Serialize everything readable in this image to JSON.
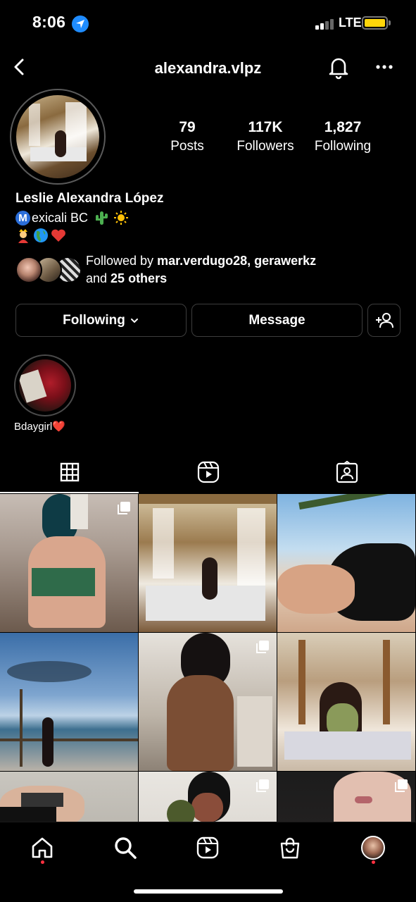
{
  "status_bar": {
    "time": "8:06",
    "network": "LTE",
    "colors": {
      "location": "#1f8cff",
      "battery": "#ffd60a"
    }
  },
  "header": {
    "username": "alexandra.vlpz",
    "icons": [
      "back-chevron-icon",
      "bell-icon",
      "more-icon"
    ]
  },
  "profile": {
    "stats": [
      {
        "value": "79",
        "label": "Posts"
      },
      {
        "value": "117K",
        "label": "Followers"
      },
      {
        "value": "1,827",
        "label": "Following"
      }
    ],
    "full_name": "Leslie Alexandra López",
    "bio_line1_badge": "M",
    "bio_line1_text": "exicali BC",
    "bio_line1_emojis": [
      "cactus",
      "sun"
    ],
    "bio_line2_emojis": [
      "woman-with-crown",
      "globe-americas",
      "red-heart"
    ],
    "followed_by": {
      "prefix": "Followed by ",
      "names": "mar.verdugo28, gerawerkz",
      "line2_prefix": "and ",
      "others": "25 others"
    }
  },
  "actions": {
    "following": "Following",
    "message": "Message"
  },
  "highlights": [
    {
      "label": "Bdaygirl❤️"
    }
  ],
  "tabs": [
    "grid-icon",
    "reels-icon",
    "tagged-icon"
  ],
  "grid": {
    "cells": 9,
    "multi_photo_cells": [
      0,
      4,
      7,
      8
    ]
  },
  "bottom_nav": [
    "home-icon",
    "search-icon",
    "reels-icon",
    "shop-icon",
    "profile-avatar"
  ],
  "colors": {
    "background": "#000000",
    "notification_dot": "#ff3040",
    "button_border": "#3d3d3d"
  }
}
